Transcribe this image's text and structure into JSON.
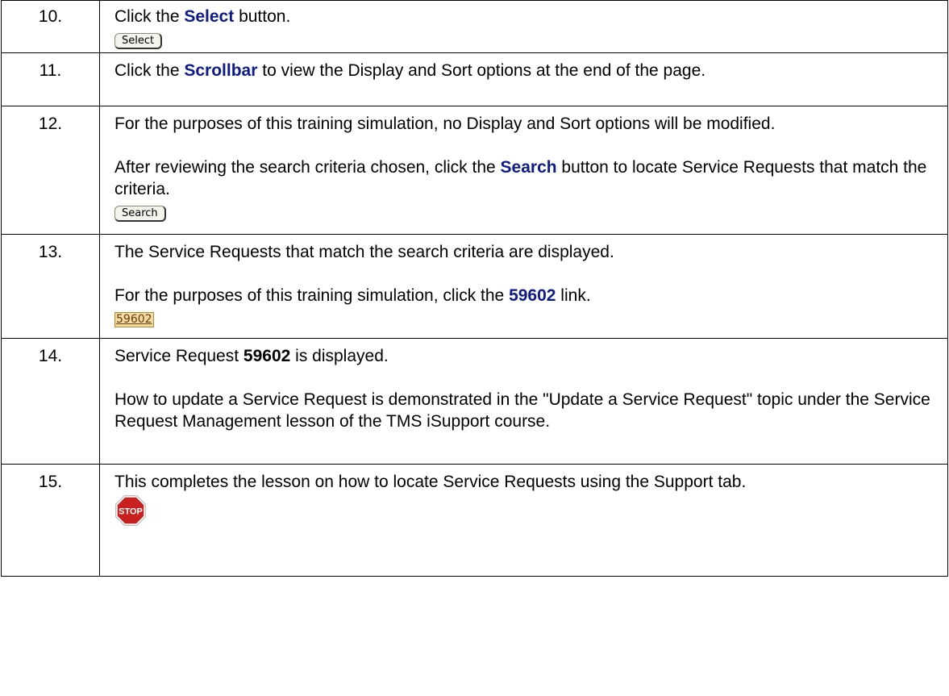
{
  "steps": [
    {
      "num": "10.",
      "parts": {
        "pre": "Click the ",
        "kw": "Select",
        "post": " button."
      },
      "button": "Select"
    },
    {
      "num": "11.",
      "parts": {
        "pre": "Click the ",
        "kw": "Scrollbar",
        "post": " to view the Display and Sort options at the end of the page."
      }
    },
    {
      "num": "12.",
      "p1": "For the purposes of this training simulation, no Display and Sort options will be modified.",
      "parts": {
        "pre": "After reviewing the search criteria chosen, click the ",
        "kw": "Search",
        "post": " button to locate Service Requests that match the criteria."
      },
      "button": "Search"
    },
    {
      "num": "13.",
      "p1": "The Service Requests that match the search criteria are displayed.",
      "parts": {
        "pre": "For the purposes of this training simulation, click the ",
        "kw": "59602",
        "post": " link."
      },
      "link": "59602"
    },
    {
      "num": "14.",
      "parts": {
        "pre": "Service Request ",
        "kw": "59602",
        "post": " is displayed."
      },
      "p2": "How to update a Service Request is demonstrated in the \"Update a Service Request\" topic under the Service Request Management lesson of the TMS iSupport course."
    },
    {
      "num": "15.",
      "p1": "This completes the lesson on how to locate Service Requests using the Support tab.",
      "stop_label": "STOP"
    }
  ]
}
